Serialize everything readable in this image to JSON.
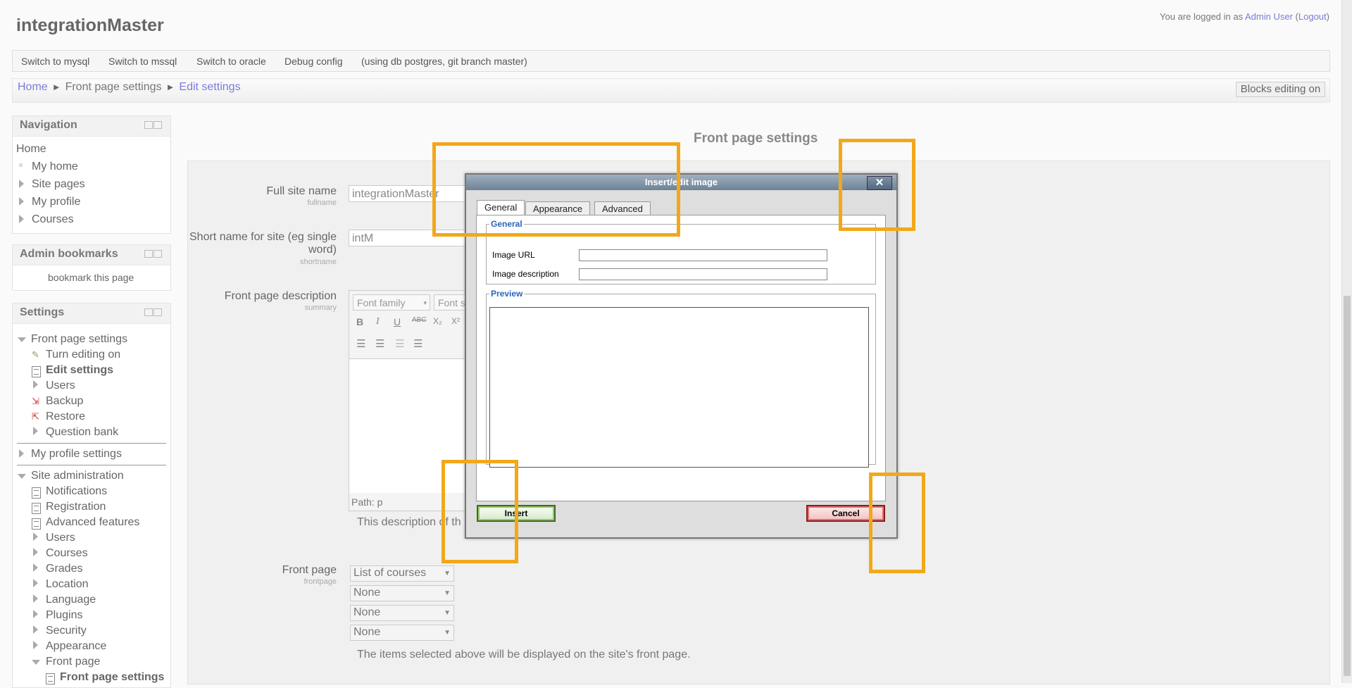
{
  "site": {
    "title": "integrationMaster"
  },
  "login": {
    "prefix": "You are logged in as ",
    "user": "Admin User",
    "open_paren": " (",
    "logout": "Logout",
    "close_paren": ")"
  },
  "custommenu": [
    "Switch to mysql",
    "Switch to mssql",
    "Switch to oracle",
    "Debug config",
    "(using db postgres, git branch master)"
  ],
  "breadcrumb": {
    "home": "Home",
    "sep": "►",
    "parent": "Front page settings",
    "current": "Edit settings"
  },
  "blocks_button": "Blocks editing on",
  "navigation_block": {
    "title": "Navigation",
    "items": [
      "Home",
      "My home",
      "Site pages",
      "My profile",
      "Courses"
    ]
  },
  "bookmarks_block": {
    "title": "Admin bookmarks",
    "link": "bookmark this page"
  },
  "settings_block": {
    "title": "Settings",
    "front_page_settings": "Front page settings",
    "front_items": [
      "Turn editing on",
      "Edit settings",
      "Users",
      "Backup",
      "Restore",
      "Question bank"
    ],
    "my_profile_settings": "My profile settings",
    "site_admin": "Site administration",
    "admin_links": [
      "Notifications",
      "Registration",
      "Advanced features"
    ],
    "admin_items": [
      "Users",
      "Courses",
      "Grades",
      "Location",
      "Language",
      "Plugins",
      "Security",
      "Appearance"
    ],
    "front_page": "Front page",
    "front_page_child": "Front page settings"
  },
  "page_heading": "Front page settings",
  "form": {
    "fullname_label": "Full site name",
    "fullname_sub": "fullname",
    "fullname_value": "integrationMaster",
    "shortname_label": "Short name for site (eg single word)",
    "shortname_sub": "shortname",
    "shortname_value": "intM",
    "summary_label": "Front page description",
    "summary_sub": "summary",
    "font_family": "Font family",
    "font_size": "Font s",
    "path": "Path: p",
    "description_note": "This description of th",
    "frontpage_label": "Front page",
    "frontpage_sub": "frontpage",
    "frontpage_selects": [
      "List of courses",
      "None",
      "None",
      "None"
    ],
    "frontpage_note": "The items selected above will be displayed on the site's front page."
  },
  "dialog": {
    "title": "Insert/edit image",
    "close": "✕",
    "tabs": [
      "General",
      "Appearance",
      "Advanced"
    ],
    "general_legend": "General",
    "image_url_label": "Image URL",
    "image_url_value": "",
    "image_desc_label": "Image description",
    "image_desc_value": "",
    "preview_legend": "Preview",
    "insert": "Insert",
    "cancel": "Cancel"
  }
}
